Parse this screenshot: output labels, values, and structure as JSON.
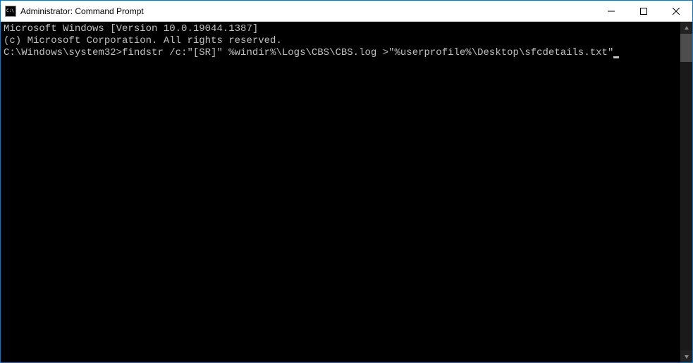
{
  "titlebar": {
    "title": "Administrator: Command Prompt"
  },
  "terminal": {
    "line1": "Microsoft Windows [Version 10.0.19044.1387]",
    "line2": "(c) Microsoft Corporation. All rights reserved.",
    "blank": "",
    "prompt": "C:\\Windows\\system32>",
    "command": "findstr /c:\"[SR]\" %windir%\\Logs\\CBS\\CBS.log >\"%userprofile%\\Desktop\\sfcdetails.txt\""
  }
}
